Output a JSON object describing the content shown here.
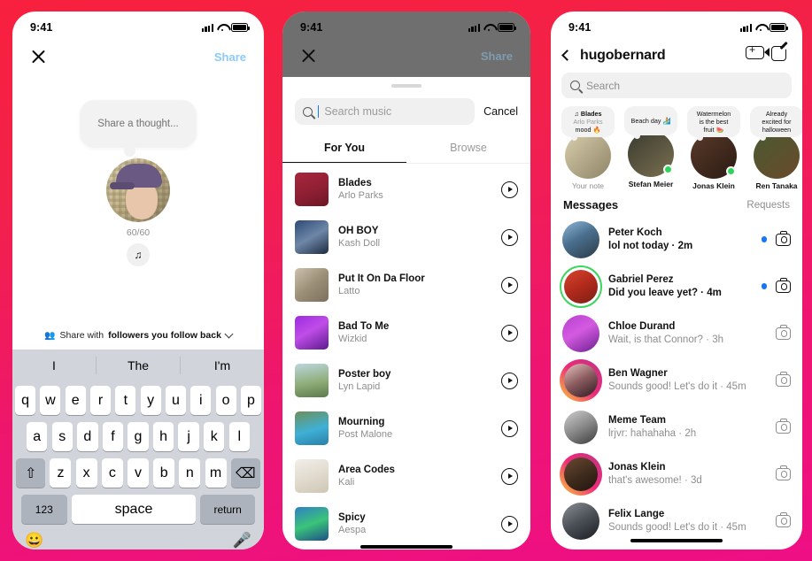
{
  "background": {
    "from": "#F8203E",
    "to": "#EE0F85"
  },
  "phone1": {
    "status": {
      "time": "9:41",
      "signal_icon": "cellular-bars-icon",
      "wifi_icon": "wifi-icon",
      "battery_icon": "battery-icon"
    },
    "nav": {
      "close_icon": "close-icon",
      "share_label": "Share"
    },
    "thought_placeholder": "Share a thought...",
    "char_counter": "60/60",
    "music_icon": "music-note-icon",
    "audience": {
      "prefix": "Share with",
      "bold": "followers you follow back",
      "people_icon": "people-icon",
      "chevron_icon": "chevron-down-icon"
    },
    "keyboard": {
      "suggestions": [
        "I",
        "The",
        "I'm"
      ],
      "row1": [
        "q",
        "w",
        "e",
        "r",
        "t",
        "y",
        "u",
        "i",
        "o",
        "p"
      ],
      "row2": [
        "a",
        "s",
        "d",
        "f",
        "g",
        "h",
        "j",
        "k",
        "l"
      ],
      "row3": [
        "z",
        "x",
        "c",
        "v",
        "b",
        "n",
        "m"
      ],
      "shift_icon": "shift-icon",
      "backspace_icon": "backspace-icon",
      "numbers_key": "123",
      "space_key": "space",
      "return_key": "return",
      "emoji_icon": "emoji-icon",
      "mic_icon": "microphone-icon"
    }
  },
  "phone2": {
    "status": {
      "time": "9:41"
    },
    "nav": {
      "close_icon": "close-icon",
      "share_label": "Share"
    },
    "search": {
      "placeholder": "Search music",
      "icon": "search-icon",
      "value": ""
    },
    "cancel_label": "Cancel",
    "tabs": [
      {
        "label": "For You",
        "active": true
      },
      {
        "label": "Browse",
        "active": false
      }
    ],
    "tracks": [
      {
        "name": "Blades",
        "artist": "Arlo Parks",
        "art": "linear-gradient(160deg,#a8263c 0%,#8e1f33 55%,#6d1626 100%)"
      },
      {
        "name": "OH BOY",
        "artist": "Kash Doll",
        "art": "linear-gradient(150deg,#2c4a74 0%,#6e87a8 50%,#1d2b40 100%)"
      },
      {
        "name": "Put It On Da Floor",
        "artist": "Latto",
        "art": "linear-gradient(140deg,#cdc2ad 0%,#9c8f78 50%,#7b705c 100%)"
      },
      {
        "name": "Bad To Me",
        "artist": "Wizkid",
        "art": "linear-gradient(150deg,#9b2ae0 0%,#c04de8 45%,#5e1a8f 100%)"
      },
      {
        "name": "Poster boy",
        "artist": "Lyn Lapid",
        "art": "linear-gradient(170deg,#bcd6de 0%,#8fae7a 55%,#5d7a4a 100%)"
      },
      {
        "name": "Mourning",
        "artist": "Post Malone",
        "art": "linear-gradient(165deg,#6f8f5a 0%,#3fb0d6 55%,#2a7fa8 100%)"
      },
      {
        "name": "Area Codes",
        "artist": "Kali",
        "art": "linear-gradient(160deg,#f2efe9 0%,#ded7c9 60%,#cfc6b4 100%)"
      },
      {
        "name": "Spicy",
        "artist": "Aespa",
        "art": "linear-gradient(160deg,#2f7fc4 0%,#3bc47a 50%,#1c4f86 100%)"
      }
    ],
    "play_icon": "play-icon"
  },
  "phone3": {
    "status": {
      "time": "9:41"
    },
    "nav": {
      "back_icon": "back-chevron-icon",
      "title": "hugobernard",
      "video_icon": "video-call-add-icon",
      "compose_icon": "compose-icon"
    },
    "search": {
      "placeholder": "Search",
      "icon": "search-icon"
    },
    "notes": [
      {
        "lines": [
          "Blades",
          "Arlo Parks",
          "mood 🔥"
        ],
        "has_music_icon": true,
        "name": "Your note",
        "name_grey": true,
        "online": false,
        "avatar": "hat-portrait"
      },
      {
        "lines": [
          "Beach day 🏄"
        ],
        "has_music_icon": false,
        "name": "Stefan Meier",
        "name_grey": false,
        "online": true,
        "avatar": "dark-portrait"
      },
      {
        "lines": [
          "Watermelon",
          "is the best",
          "fruit 🍉"
        ],
        "has_music_icon": false,
        "name": "Jonas Klein",
        "name_grey": false,
        "online": true,
        "avatar": "smiling-portrait"
      },
      {
        "lines": [
          "Already",
          "excited for",
          "halloween"
        ],
        "has_music_icon": false,
        "name": "Ren Tanaka",
        "name_grey": false,
        "online": false,
        "avatar": "green-portrait"
      }
    ],
    "messages_header": {
      "title": "Messages",
      "requests": "Requests"
    },
    "messages": [
      {
        "name": "Peter Koch",
        "preview": "lol not today",
        "time": "2m",
        "unread": true,
        "ring": "none",
        "avatar": "linear-gradient(150deg,#8fb8d8 0%,#4a6f8e 45%,#2b3a44 100%)",
        "camera_icon": "camera-icon"
      },
      {
        "name": "Gabriel Perez",
        "preview": "Did you leave yet?",
        "time": "4m",
        "unread": true,
        "ring": "close-friends",
        "avatar": "linear-gradient(150deg,#d8452e 0%,#b02a1c 50%,#7a1f14 100%)",
        "camera_icon": "camera-icon"
      },
      {
        "name": "Chloe Durand",
        "preview": "Wait, is that Connor?",
        "time": "3h",
        "unread": false,
        "ring": "none",
        "avatar": "linear-gradient(150deg,#b43fd0 0%,#d45ae0 45%,#6b1f8f 100%)",
        "camera_icon": "camera-icon"
      },
      {
        "name": "Ben Wagner",
        "preview": "Sounds good! Let's do it",
        "time": "45m",
        "unread": false,
        "ring": "story",
        "avatar": "linear-gradient(150deg,#e8c6c0 0%,#8a5a5e 50%,#2a1a22 100%)",
        "camera_icon": "camera-icon"
      },
      {
        "name": "Meme Team",
        "preview": "lrjvr: hahahaha",
        "time": "2h",
        "unread": false,
        "ring": "group",
        "avatar": "linear-gradient(150deg,#cfcfcf 0%,#8a8a8a 50%,#3a3a3a 100%)",
        "camera_icon": "camera-icon"
      },
      {
        "name": "Jonas Klein",
        "preview": "that's awesome!",
        "time": "3d",
        "unread": false,
        "ring": "story",
        "avatar": "linear-gradient(150deg,#6b4a32 0%,#3d2a1c 55%,#201510 100%)",
        "camera_icon": "camera-icon"
      },
      {
        "name": "Felix Lange",
        "preview": "Sounds good! Let's do it",
        "time": "45m",
        "unread": false,
        "ring": "none",
        "avatar": "linear-gradient(150deg,#8a8f96 0%,#4a4f56 50%,#1a1d22 100%)",
        "camera_icon": "camera-icon"
      }
    ]
  }
}
